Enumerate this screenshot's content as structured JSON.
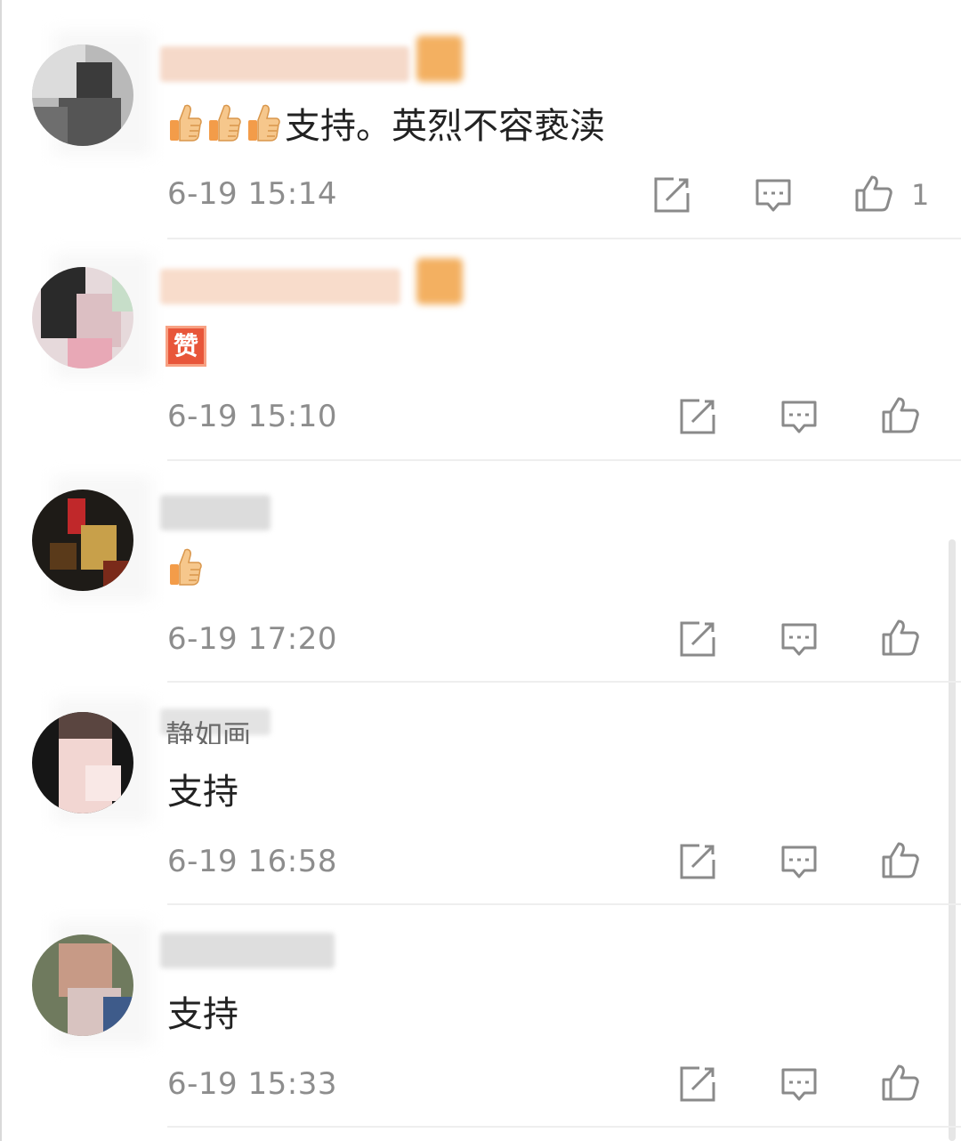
{
  "comments": [
    {
      "content": "支持。英烈不容亵渎",
      "time": "6-19 15:14",
      "like_count": "1"
    },
    {
      "content": "赞",
      "time": "6-19 15:10",
      "like_count": ""
    },
    {
      "content": "",
      "time": "6-19 17:20",
      "like_count": ""
    },
    {
      "username": "静如画",
      "content": "支持",
      "time": "6-19 16:58",
      "like_count": ""
    },
    {
      "content": "支持",
      "time": "6-19 15:33",
      "like_count": ""
    }
  ],
  "icons": {
    "share": "share-icon",
    "reply": "comment-icon",
    "like": "thumbs-up-icon",
    "emoji_thumb": "thumbs-up-emoji",
    "emoji_zan": "zan-emoji"
  },
  "colors": {
    "text": "#222222",
    "meta": "#8d8d8d",
    "zan_red": "#e8563a",
    "thumb_skin": "#f6c78c",
    "badge_orange": "#f3b061"
  }
}
